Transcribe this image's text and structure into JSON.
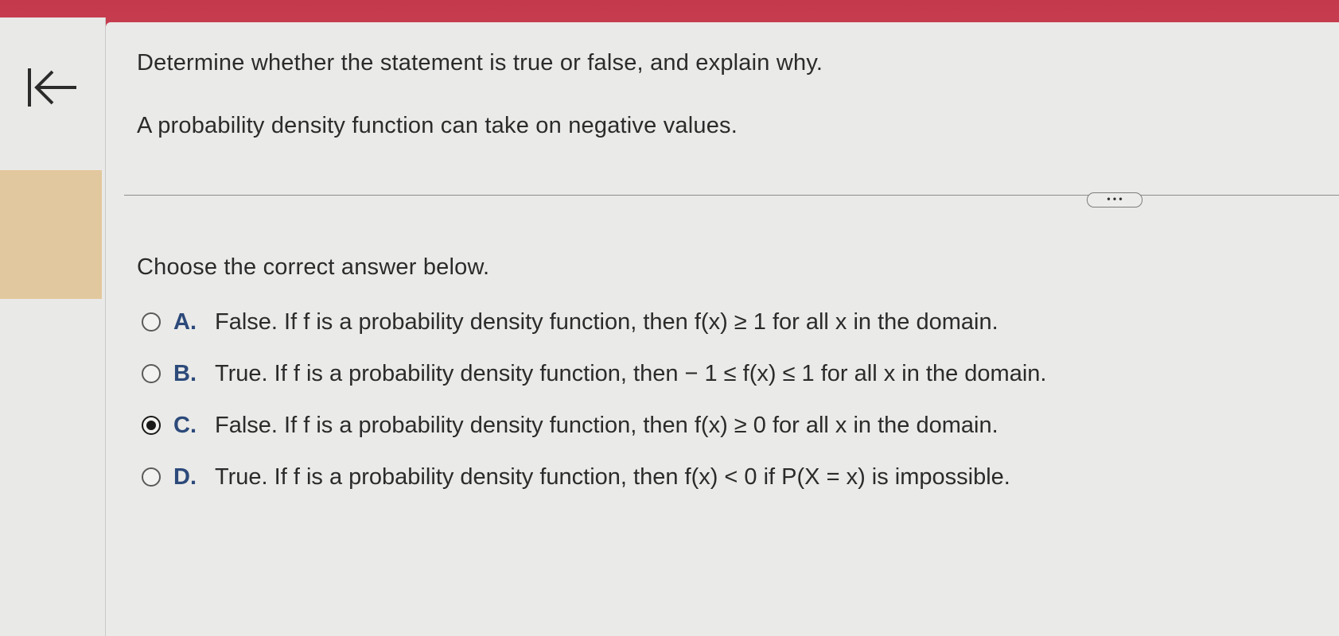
{
  "question": {
    "instruction": "Determine whether the statement is true or false, and explain why.",
    "statement": "A probability density function can take on negative values.",
    "more_label": "• • •",
    "choose_prompt": "Choose the correct answer below."
  },
  "options": [
    {
      "letter": "A.",
      "text": "False. If f is a probability density function, then f(x) ≥ 1 for all x in the domain.",
      "selected": false
    },
    {
      "letter": "B.",
      "text": "True. If f is a probability density function, then − 1 ≤ f(x) ≤ 1 for all x in the domain.",
      "selected": false
    },
    {
      "letter": "C.",
      "text": "False. If f is a probability density function, then f(x) ≥ 0 for all x in the domain.",
      "selected": true
    },
    {
      "letter": "D.",
      "text": "True. If f is a probability density function, then f(x) < 0 if P(X = x) is impossible.",
      "selected": false
    }
  ],
  "icons": {
    "back": "first-page-arrow-icon"
  },
  "colors": {
    "top_bar": "#c43a4c",
    "left_accent": "#e2c89e",
    "option_letter": "#2c4a7a"
  }
}
